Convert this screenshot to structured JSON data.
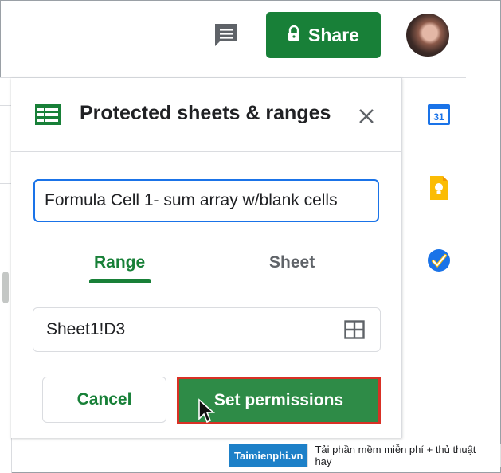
{
  "toolbar": {
    "share_label": "Share",
    "comment_icon": "comment-icon",
    "lock_icon": "lock-icon",
    "accent_color": "#188038"
  },
  "panel": {
    "title": "Protected sheets & ranges",
    "title_icon": "sheets-icon",
    "close_icon": "close-icon",
    "description_value": "Formula Cell 1- sum array w/blank cells",
    "tabs": [
      {
        "label": "Range",
        "active": true
      },
      {
        "label": "Sheet",
        "active": false
      }
    ],
    "range_value": "Sheet1!D3",
    "range_icon": "grid-select-icon",
    "cancel_label": "Cancel",
    "set_permissions_label": "Set permissions",
    "highlight_color": "#d93025"
  },
  "side_panel": {
    "icons": [
      "calendar-icon",
      "keep-icon",
      "tasks-icon"
    ],
    "calendar_day": "31"
  },
  "watermark": {
    "brand": "Taimienphi.vn",
    "tagline": "Tải phần mềm miễn phí + thủ thuật hay"
  }
}
